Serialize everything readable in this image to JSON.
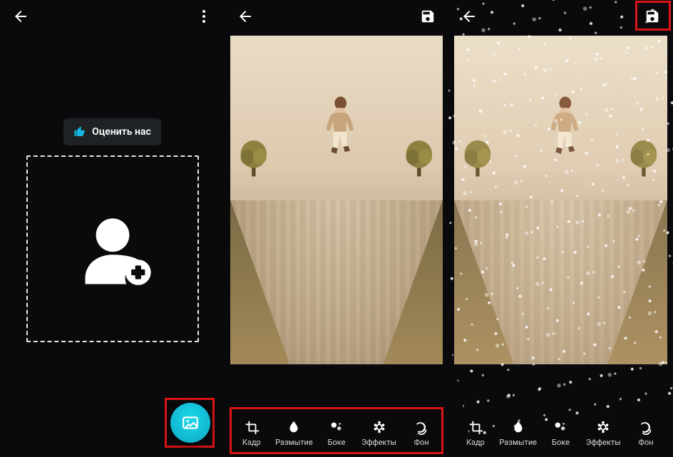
{
  "rate_label": "Оценить нас",
  "tools": [
    {
      "icon": "crop",
      "label": "Кадр"
    },
    {
      "icon": "blur",
      "label": "Размытие"
    },
    {
      "icon": "bokeh",
      "label": "Боке"
    },
    {
      "icon": "effects",
      "label": "Эффекты"
    },
    {
      "icon": "background",
      "label": "Фон"
    }
  ],
  "colors": {
    "accent": "#0ec2db",
    "danger": "#da1414"
  }
}
